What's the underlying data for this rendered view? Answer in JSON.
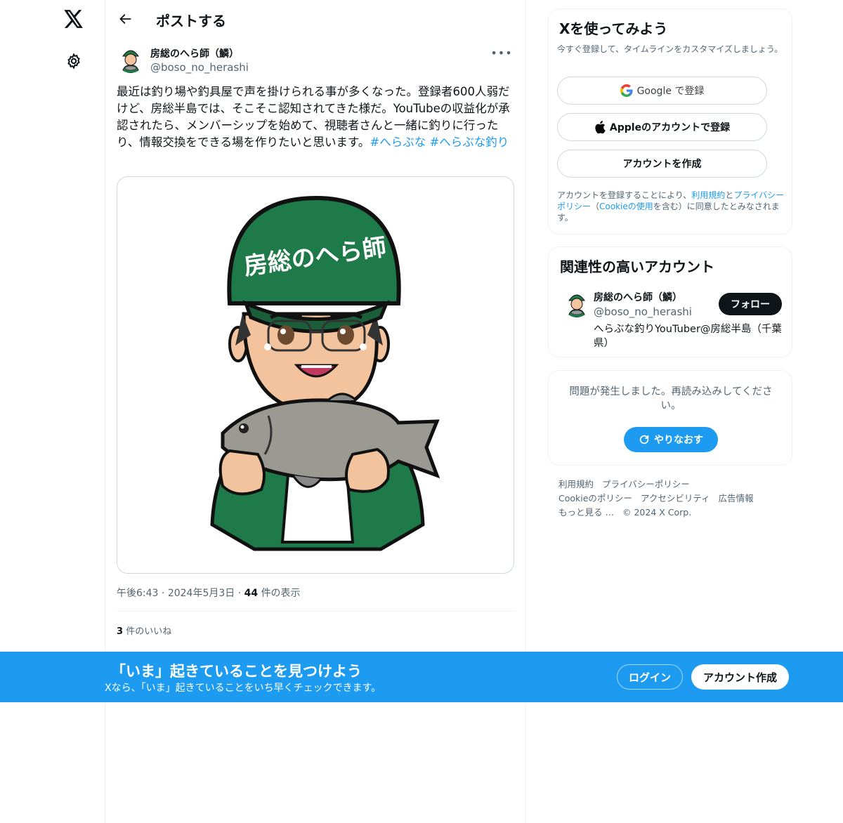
{
  "nav": {
    "logo": "x-logo",
    "settings": "gear-icon"
  },
  "header": {
    "title": "ポストする"
  },
  "post": {
    "author_name": "房総のへら師（鱗）",
    "author_handle": "@boso_no_herashi",
    "text": "最近は釣り場や釣具屋で声を掛けられる事が多くなった。登録者600人弱だけど、房総半島では、そこそこ認知されてきた様だ。YouTubeの収益化が承認されたら、メンバーシップを始めて、視聴者さんと一緒に釣りに行ったり、情報交換をできる場を作りたいと思います。",
    "hashtag1": "#へらぶな",
    "hashtag2": "#へらぶな釣り",
    "media_cap_text": "房総のへら師",
    "time": "午後6:43",
    "date": "2024年5月3日",
    "views_count": "44",
    "views_label": "件の表示",
    "likes_count": "3",
    "likes_label": "件のいいね"
  },
  "signup": {
    "title": "Xを使ってみよう",
    "subtitle": "今すぐ登録して、タイムラインをカスタマイズしましょう。",
    "google": "Google で登録",
    "apple": "Appleのアカウントで登録",
    "create": "アカウントを作成",
    "legal_1": "アカウントを登録することにより、",
    "legal_terms": "利用規約",
    "legal_2": "と",
    "legal_privacy": "プライバシーポリシー",
    "legal_3": "（",
    "legal_cookie": "Cookieの使用",
    "legal_4": "を含む）に同意したとみなされます。"
  },
  "related": {
    "title": "関連性の高いアカウント",
    "name": "房総のへら師（鱗）",
    "handle": "@boso_no_herashi",
    "bio": "へらぶな釣りYouTuber@房総半島（千葉県）",
    "follow": "フォロー"
  },
  "error_card": {
    "message": "問題が発生しました。再読み込みしてください。",
    "retry": "やりなおす"
  },
  "footer": {
    "terms": "利用規約",
    "privacy": "プライバシーポリシー",
    "cookie": "Cookieのポリシー",
    "accessibility": "アクセシビリティ",
    "ads": "広告情報",
    "more": "もっと見る …",
    "copyright": "© 2024 X Corp."
  },
  "banner": {
    "title": "「いま」起きていることを見つけよう",
    "subtitle": "Xなら、「いま」起きていることをいち早くチェックできます。",
    "login": "ログイン",
    "signup": "アカウント作成"
  },
  "colors": {
    "accent": "#1d9bf0",
    "cap_green": "#1f7a4a",
    "dark": "#0f1419"
  }
}
